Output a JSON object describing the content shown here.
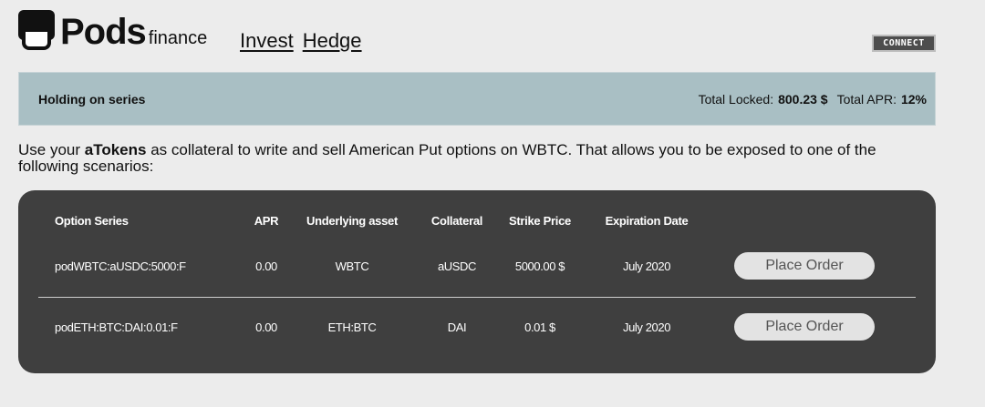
{
  "brand": {
    "name": "Pods",
    "suffix": "finance"
  },
  "nav": [
    {
      "label": "Invest"
    },
    {
      "label": "Hedge"
    }
  ],
  "connect_label": "CONNECT",
  "holding": {
    "title": "Holding on series",
    "total_locked_label": "Total Locked:",
    "total_locked_value": "800.23 $",
    "total_apr_label": "Total APR:",
    "total_apr_value": "12%"
  },
  "description": {
    "prefix": "Use your ",
    "highlight": "aTokens",
    "suffix": " as collateral to write and sell American Put options on WBTC. That allows you to be exposed to one of the following scenarios:"
  },
  "table": {
    "headers": [
      "Option Series",
      "APR",
      "Underlying asset",
      "Collateral",
      "Strike Price",
      "Expiration Date"
    ],
    "rows": [
      {
        "series": "podWBTC:aUSDC:5000:F",
        "apr": "0.00",
        "underlying": "WBTC",
        "collateral": "aUSDC",
        "strike": "5000.00 $",
        "expiration": "July 2020",
        "action": "Place Order"
      },
      {
        "series": "podETH:BTC:DAI:0.01:F",
        "apr": "0.00",
        "underlying": "ETH:BTC",
        "collateral": "DAI",
        "strike": "0.01 $",
        "expiration": "July 2020",
        "action": "Place Order"
      }
    ]
  },
  "colors": {
    "page_bg": "#ececec",
    "holding_bg": "#a9bfc4",
    "panel_bg": "#3f3f3f",
    "button_bg": "#e3e3e3",
    "connect_bg": "#4d4d4d"
  },
  "icons": {
    "logo": "pods-logo-icon"
  }
}
